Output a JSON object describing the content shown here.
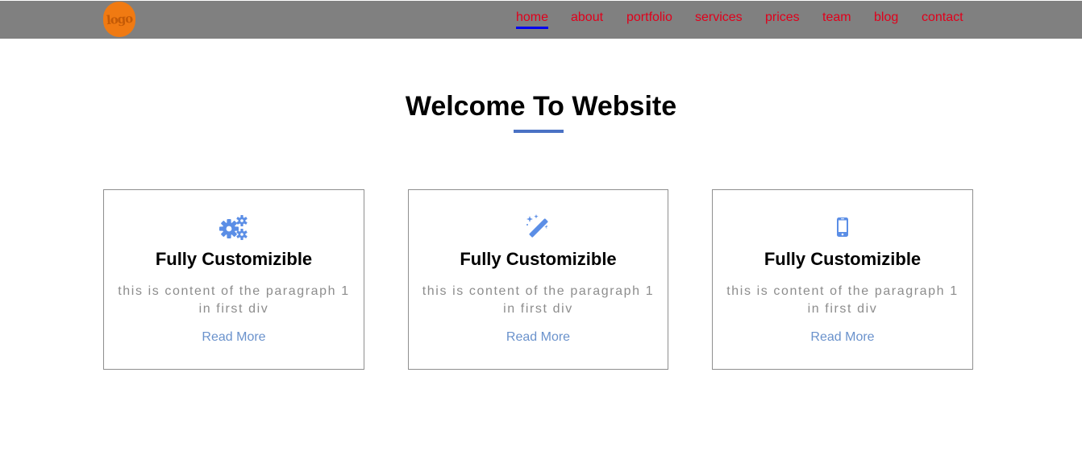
{
  "navbar": {
    "logo_text": "logo",
    "links": [
      {
        "label": "home",
        "active": true
      },
      {
        "label": "about"
      },
      {
        "label": "portfolio"
      },
      {
        "label": "services"
      },
      {
        "label": "prices"
      },
      {
        "label": "team"
      },
      {
        "label": "blog"
      },
      {
        "label": "contact"
      }
    ]
  },
  "main": {
    "title": "Welcome To Website"
  },
  "cards": [
    {
      "icon": "gears-icon",
      "title": "Fully Customizible",
      "text": "this is content of the paragraph 1 in first div",
      "link": "Read More"
    },
    {
      "icon": "magic-wand-icon",
      "title": "Fully Customizible",
      "text": "this is content of the paragraph 1 in first div",
      "link": "Read More"
    },
    {
      "icon": "mobile-phone-icon",
      "title": "Fully Customizible",
      "text": "this is content of the paragraph 1 in first div",
      "link": "Read More"
    }
  ],
  "colors": {
    "navbar_bg": "#808080",
    "nav_link": "#e0001b",
    "active_underline": "#0000ee",
    "accent": "#4a72c4",
    "icon": "#5b8ee6",
    "logo_bg": "#f07a12"
  }
}
